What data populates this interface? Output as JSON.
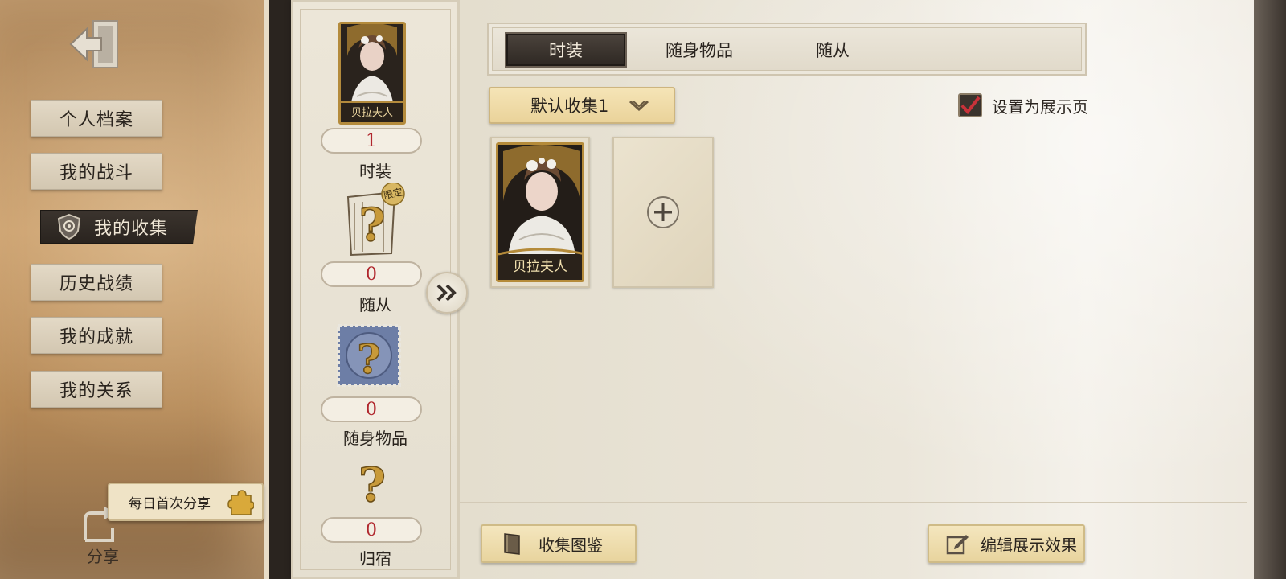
{
  "nav": {
    "items": [
      {
        "label": "个人档案",
        "active": false
      },
      {
        "label": "我的战斗",
        "active": false
      },
      {
        "label": "我的收集",
        "active": true
      },
      {
        "label": "历史战绩",
        "active": false
      },
      {
        "label": "我的成就",
        "active": false
      },
      {
        "label": "我的关系",
        "active": false
      }
    ],
    "daily_share": "每日首次分享",
    "share_label": "分享"
  },
  "summary": {
    "featured_card_name": "贝拉夫人",
    "limited_badge": "限定",
    "counts": [
      {
        "value": "1",
        "label": "时装"
      },
      {
        "value": "0",
        "label": "随从"
      },
      {
        "value": "0",
        "label": "随身物品"
      },
      {
        "value": "0",
        "label": "归宿"
      }
    ]
  },
  "tabs": [
    {
      "label": "时装",
      "active": true
    },
    {
      "label": "随身物品",
      "active": false
    },
    {
      "label": "随从",
      "active": false
    }
  ],
  "collection_select": {
    "value": "默认收集1"
  },
  "display_toggle": {
    "label": "设置为展示页",
    "checked": true
  },
  "cards": [
    {
      "name": "贝拉夫人"
    }
  ],
  "bottom": {
    "catalog_button": "收集图鉴",
    "edit_button": "编辑展示效果"
  },
  "colors": {
    "count_red": "#b0262d",
    "gold_frame": "#b58b3a",
    "dark_button": "#2f2924",
    "parchment": "#ebe6da"
  }
}
